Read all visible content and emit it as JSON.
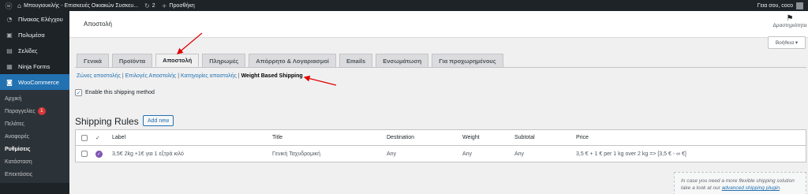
{
  "admin_bar": {
    "site_name": "Μπουγιουκλής - Επισκευές Οικιακών Συσκευ...",
    "comments_count": "2",
    "new_label": "Προσθήκη",
    "greeting": "Γεια σου, coco"
  },
  "sidebar": {
    "items": [
      {
        "label": "Πίνακας Ελέγχου",
        "icon": "dashboard-icon"
      },
      {
        "label": "Πολυμέσα",
        "icon": "media-icon"
      },
      {
        "label": "Σελίδες",
        "icon": "pages-icon"
      },
      {
        "label": "Ninja Forms",
        "icon": "forms-icon"
      },
      {
        "label": "WooCommerce",
        "icon": "woocommerce-icon"
      }
    ],
    "submenu": [
      {
        "label": "Αρχική"
      },
      {
        "label": "Παραγγελίες",
        "badge": "1"
      },
      {
        "label": "Πελάτες"
      },
      {
        "label": "Αναφορές"
      },
      {
        "label": "Ρυθμίσεις"
      },
      {
        "label": "Κατάσταση"
      },
      {
        "label": "Επεκτάσεις"
      }
    ]
  },
  "header": {
    "title": "Αποστολή",
    "activity_label": "Δραστηριότητα",
    "help_label": "Βοήθεια ▾"
  },
  "tabs": [
    {
      "label": "Γενικά"
    },
    {
      "label": "Προϊόντα"
    },
    {
      "label": "Αποστολή"
    },
    {
      "label": "Πληρωμές"
    },
    {
      "label": "Απόρρητο & Λογαριασμοί"
    },
    {
      "label": "Emails"
    },
    {
      "label": "Ενσωμάτωση"
    },
    {
      "label": "Για προχωρημένους"
    }
  ],
  "subsections": {
    "zones": "Ζώνες αποστολής",
    "options": "Επιλογές Αποστολής",
    "classes": "Κατηγορίες αποστολής",
    "weight_based": "Weight Based Shipping"
  },
  "enable_checkbox": {
    "label": "Enable this shipping method",
    "checked": true
  },
  "shipping_rules": {
    "title": "Shipping Rules",
    "add_new": "Add new",
    "columns": [
      "Label",
      "Title",
      "Destination",
      "Weight",
      "Subtotal",
      "Price"
    ],
    "rows": [
      {
        "label": "3,5€ 2kg +1€ για 1 εξτρά κιλό",
        "title": "Γενική Ταχυδρομική",
        "destination": "Any",
        "weight": "Any",
        "subtotal": "Any",
        "price": "3,5 € + 1 € per 1 kg over 2 kg => [3,5 € - ∞ €]"
      }
    ]
  },
  "info_box": {
    "text": "In case you need a more flexible shipping solution take a look at our",
    "link": "advanced shipping plugin"
  },
  "colors": {
    "admin_dark": "#1d2327",
    "accent_blue": "#2271b1",
    "annotation_red": "#e00000",
    "woo_purple": "#7f54b3"
  }
}
